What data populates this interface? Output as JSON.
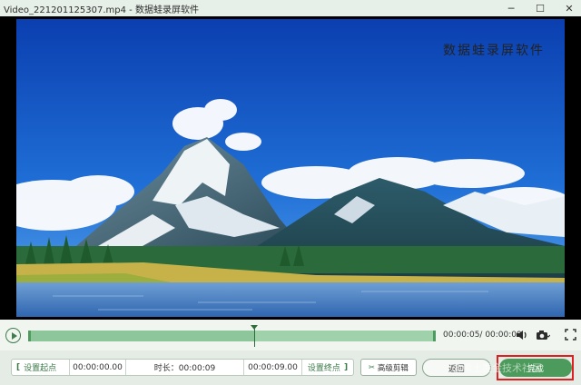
{
  "window": {
    "title": "Video_221201125307.mp4  -  数据蛙录屏软件",
    "controls": {
      "minimize": "─",
      "maximize": "☐",
      "close": "✕"
    }
  },
  "video": {
    "watermark": "数据蛙录屏软件"
  },
  "playback": {
    "progress": 0.555,
    "timecode": "00:00:05/ 00:00:09",
    "icons": [
      "play-icon",
      "volume-icon",
      "camera-icon",
      "fullscreen-icon"
    ]
  },
  "trim": {
    "set_start_label": "设置起点",
    "start_time": "00:00:00.00",
    "duration_label": "时长：00:00:09",
    "end_time": "00:00:09.00",
    "set_end_label": "设置终点",
    "advanced_label": "高级剪辑"
  },
  "actions": {
    "back_label": "返回",
    "finish_label": "完成"
  },
  "overlay": {
    "site_watermark": "@稀土掘金技术社区"
  },
  "colors": {
    "accent": "#4d9b5c",
    "track": "#9fd1aa",
    "highlight": "#e02020"
  }
}
